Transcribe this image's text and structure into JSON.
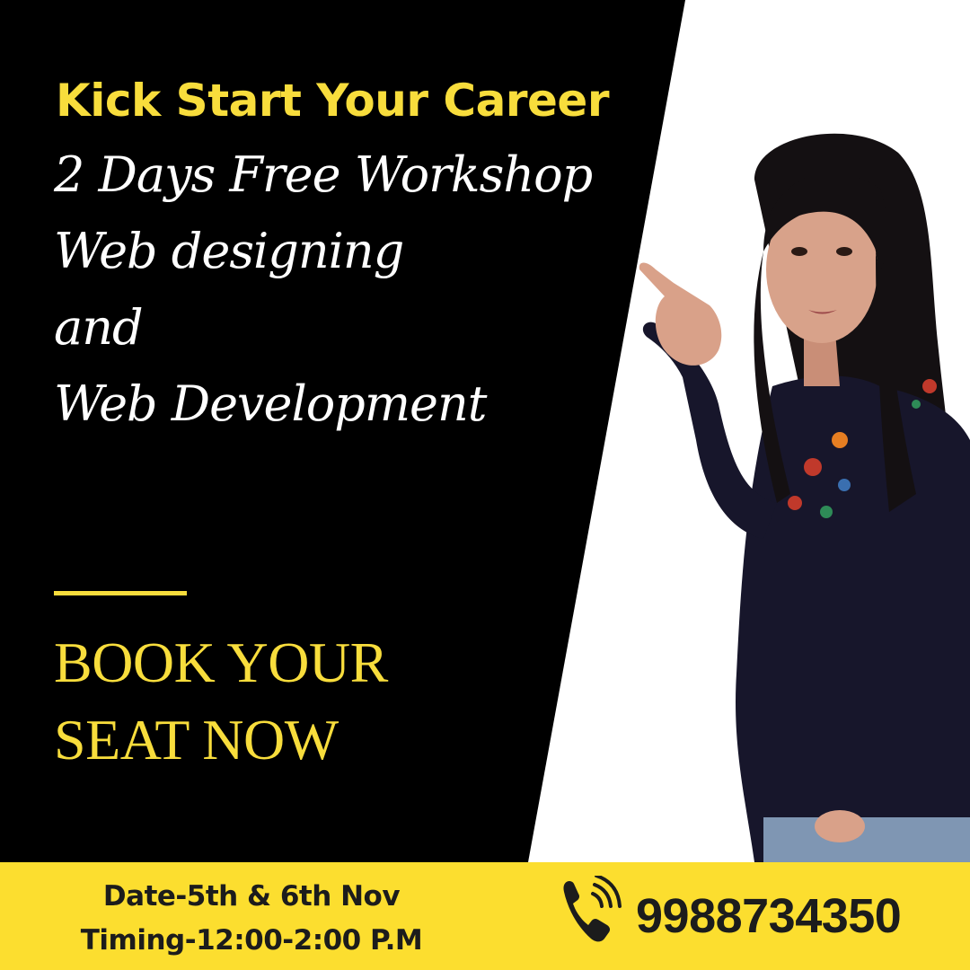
{
  "colors": {
    "panel": "#000000",
    "accent_yellow": "#f8dd3c",
    "footer_yellow": "#fcde2f",
    "text_white": "#ffffff",
    "text_dark": "#1c1c1c"
  },
  "headline": "Kick Start Your Career",
  "sublines": [
    "2 Days Free Workshop",
    "Web designing",
    "and",
    "Web Development"
  ],
  "cta": {
    "line1": "BOOK YOUR",
    "line2": "SEAT NOW"
  },
  "footer": {
    "date": "Date-5th & 6th Nov",
    "timing": "Timing-12:00-2:00 P.M",
    "phone_icon": "phone-icon",
    "phone": "9988734350"
  }
}
